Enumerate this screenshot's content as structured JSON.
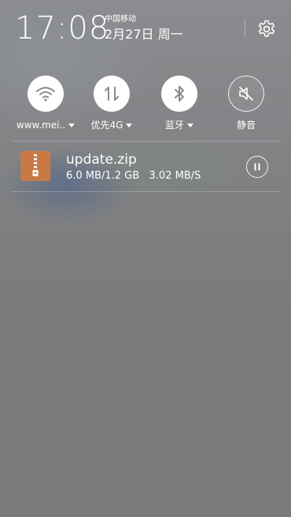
{
  "status": {
    "time": "17:08",
    "carrier": "中国移动",
    "date": "2月27日 周一"
  },
  "settings": {
    "icon": "gear-icon"
  },
  "toggles": [
    {
      "id": "wifi",
      "label": "www.mei..",
      "icon": "wifi-icon",
      "state": "on",
      "has_menu": true
    },
    {
      "id": "mobile-data",
      "label": "优先4G",
      "icon": "data-arrows-icon",
      "state": "on",
      "has_menu": true
    },
    {
      "id": "bluetooth",
      "label": "蓝牙",
      "icon": "bluetooth-icon",
      "state": "on",
      "has_menu": true
    },
    {
      "id": "mute",
      "label": "静音",
      "icon": "mute-icon",
      "state": "off",
      "has_menu": false
    }
  ],
  "notification": {
    "title": "update.zip",
    "progress_text": "6.0 MB/1.2 GB",
    "speed": "3.02 MB/S",
    "icon": "zip-file-icon",
    "action_icon": "pause-icon"
  },
  "colors": {
    "toggle_on_bg": "#ffffff",
    "toggle_icon": "#8a8a8a",
    "zip_icon": "#c97a44"
  }
}
